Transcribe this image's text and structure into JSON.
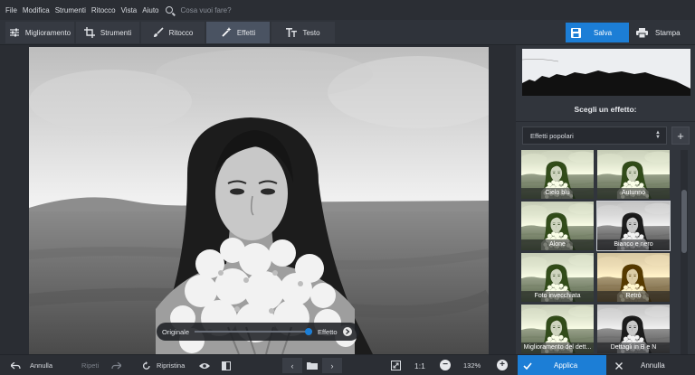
{
  "menu": {
    "items": [
      "File",
      "Modifica",
      "Strumenti",
      "Ritocco",
      "Vista",
      "Aiuto"
    ],
    "search_placeholder": "Cosa vuoi fare?"
  },
  "toolbar": {
    "tabs": [
      {
        "label": "Miglioramento",
        "icon": "sliders-icon"
      },
      {
        "label": "Strumenti",
        "icon": "crop-icon"
      },
      {
        "label": "Ritocco",
        "icon": "brush-icon"
      },
      {
        "label": "Effetti",
        "icon": "magic-wand-icon",
        "active": true
      },
      {
        "label": "Testo",
        "icon": "text-icon"
      }
    ],
    "save_label": "Salva",
    "print_label": "Stampa"
  },
  "compare": {
    "left_label": "Originale",
    "right_label": "Effetto"
  },
  "panel": {
    "title": "Scegli un effetto:",
    "dropdown_value": "Effetti popolari",
    "effects": [
      {
        "label": "Cielo blu",
        "tone": "color"
      },
      {
        "label": "Autunno",
        "tone": "color"
      },
      {
        "label": "Alone",
        "tone": "color"
      },
      {
        "label": "Bianco e nero",
        "tone": "bw",
        "selected": true
      },
      {
        "label": "Foto invecchiata",
        "tone": "color"
      },
      {
        "label": "Retrò",
        "tone": "sepia"
      },
      {
        "label": "Miglioramento del dett...",
        "tone": "color"
      },
      {
        "label": "Dettagli in B e N",
        "tone": "bw"
      }
    ]
  },
  "bottom": {
    "undo_label": "Annulla",
    "redo_label": "Ripeti",
    "reset_label": "Ripristina",
    "one_to_one": "1:1",
    "zoom": "132%",
    "apply_label": "Applica",
    "cancel_label": "Annulla"
  },
  "colors": {
    "accent": "#1c7ed6",
    "background": "#2b2f36",
    "panel": "#31353c"
  }
}
